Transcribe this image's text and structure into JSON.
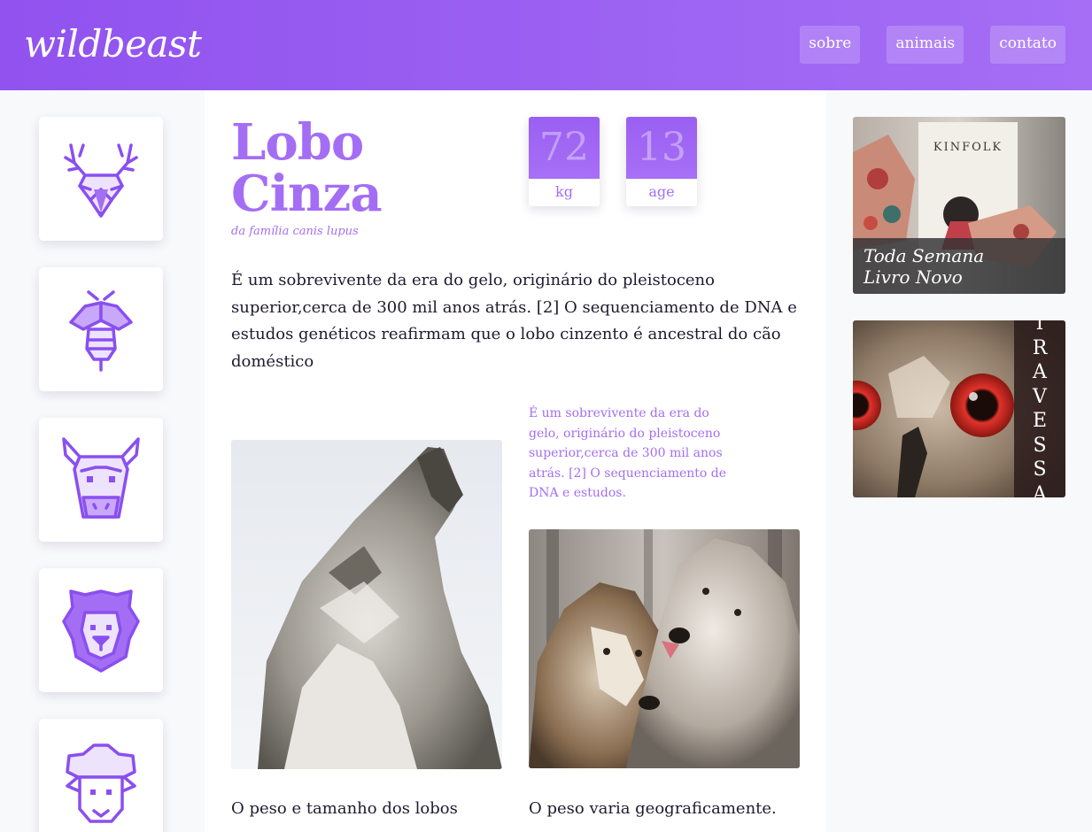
{
  "header": {
    "logo": "wildbeast",
    "nav": [
      {
        "label": "sobre"
      },
      {
        "label": "animais"
      },
      {
        "label": "contato"
      }
    ]
  },
  "sidebar": {
    "icons": [
      {
        "name": "deer-icon"
      },
      {
        "name": "bee-icon"
      },
      {
        "name": "bull-icon"
      },
      {
        "name": "lion-icon"
      },
      {
        "name": "sheep-icon"
      }
    ]
  },
  "animal": {
    "title_line1": "Lobo",
    "title_line2": "Cinza",
    "subtitle": "da família canis lupus",
    "stats": [
      {
        "value": "72",
        "unit": "kg"
      },
      {
        "value": "13",
        "unit": "age"
      }
    ],
    "intro": "É um sobrevivente da era do gelo, originário do pleistoceno superior,cerca de 300 mil anos atrás. [2] O sequenciamento de DNA e estudos genéticos reafirmam que o lobo cinzento é ancestral do cão doméstico",
    "side_note": "É um sobrevivente da era do gelo, originário do pleistoceno superior,cerca de 300 mil anos atrás. [2] O sequenciamento de DNA e estudos.",
    "col_left_text": "O peso e tamanho dos lobos",
    "col_right_text": "O peso varia geograficamente."
  },
  "ads": [
    {
      "caption_line1": "Toda Semana",
      "caption_line2": "Livro Novo",
      "magazine": "KINFOLK"
    },
    {
      "letters": [
        "T",
        "R",
        "A",
        "V",
        "E",
        "S",
        "S",
        "A"
      ]
    }
  ],
  "colors": {
    "accent": "#a46ef4",
    "header_start": "#9152ef",
    "header_end": "#a56ef5",
    "icon_stroke": "#8a4ff0"
  }
}
